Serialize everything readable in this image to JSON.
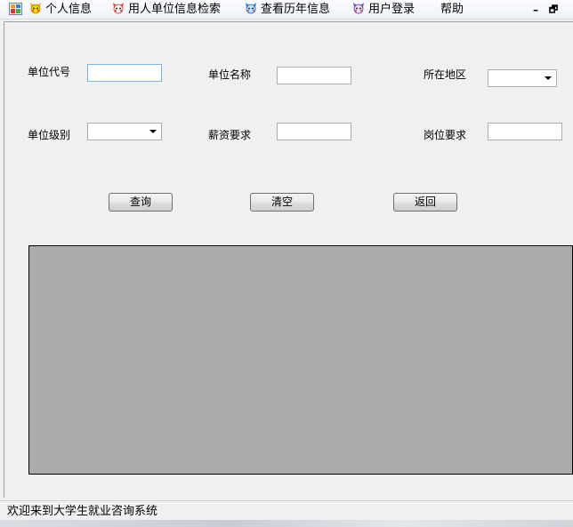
{
  "menubar": {
    "items": [
      {
        "label": "个人信息",
        "icon": "cartoon-face-icon"
      },
      {
        "label": "用人单位信息检索",
        "icon": "cartoon-face-icon"
      },
      {
        "label": "查看历年信息",
        "icon": "cartoon-face-icon"
      },
      {
        "label": "用户登录",
        "icon": "cartoon-face-icon"
      },
      {
        "label": "帮助"
      }
    ],
    "minimize_glyph": "–",
    "restore_glyph": "🗗"
  },
  "form": {
    "unit_code_label": "单位代号",
    "unit_code_value": "",
    "unit_name_label": "单位名称",
    "unit_name_value": "",
    "location_label": "所在地区",
    "location_value": "",
    "unit_level_label": "单位级别",
    "unit_level_value": "",
    "salary_label": "薪资要求",
    "salary_value": "",
    "position_label": "岗位要求",
    "position_value": ""
  },
  "buttons": {
    "query": "查询",
    "clear": "清空",
    "back": "返回"
  },
  "status": {
    "text": "欢迎来到大学生就业咨询系统"
  }
}
